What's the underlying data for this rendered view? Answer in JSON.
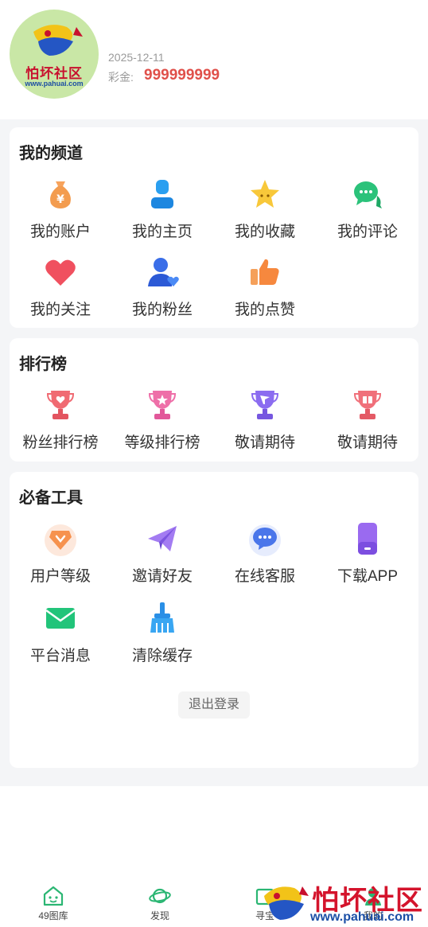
{
  "header": {
    "avatar_text": "怕坏社区",
    "avatar_url": "www.pahuai.com",
    "date": "2025-12-11",
    "points_label": "彩金:",
    "points_value": "999999999"
  },
  "my_channel": {
    "title": "我的频道",
    "items": [
      {
        "label": "我的账户",
        "icon": "money-bag-icon"
      },
      {
        "label": "我的主页",
        "icon": "user-icon"
      },
      {
        "label": "我的收藏",
        "icon": "star-icon"
      },
      {
        "label": "我的评论",
        "icon": "chat-icon"
      },
      {
        "label": "我的关注",
        "icon": "heart-icon"
      },
      {
        "label": "我的粉丝",
        "icon": "fans-icon"
      },
      {
        "label": "我的点赞",
        "icon": "thumbs-up-icon"
      }
    ]
  },
  "ranking": {
    "title": "排行榜",
    "items": [
      {
        "label": "粉丝排行榜",
        "icon": "trophy-heart-icon"
      },
      {
        "label": "等级排行榜",
        "icon": "trophy-star-icon"
      },
      {
        "label": "敬请期待",
        "icon": "trophy-flag-icon"
      },
      {
        "label": "敬请期待",
        "icon": "trophy-gift-icon"
      }
    ]
  },
  "tools": {
    "title": "必备工具",
    "items": [
      {
        "label": "用户等级",
        "icon": "diamond-badge-icon"
      },
      {
        "label": "邀请好友",
        "icon": "paper-plane-icon"
      },
      {
        "label": "在线客服",
        "icon": "support-chat-icon"
      },
      {
        "label": "下载APP",
        "icon": "phone-icon"
      },
      {
        "label": "平台消息",
        "icon": "envelope-icon"
      },
      {
        "label": "清除缓存",
        "icon": "broom-icon"
      }
    ],
    "logout_label": "退出登录"
  },
  "tabbar": {
    "items": [
      {
        "label": "49图库",
        "icon": "gallery-icon"
      },
      {
        "label": "发现",
        "icon": "planet-icon"
      },
      {
        "label": "寻宝",
        "icon": "treasure-icon"
      },
      {
        "label": "我的",
        "icon": "profile-icon"
      }
    ]
  },
  "watermark": {
    "text": "怕坏社区",
    "url": "www.pahuai.com"
  },
  "colors": {
    "accent_green": "#2bb673",
    "points_red": "#e0504a",
    "page_gray": "#f4f5f7"
  }
}
